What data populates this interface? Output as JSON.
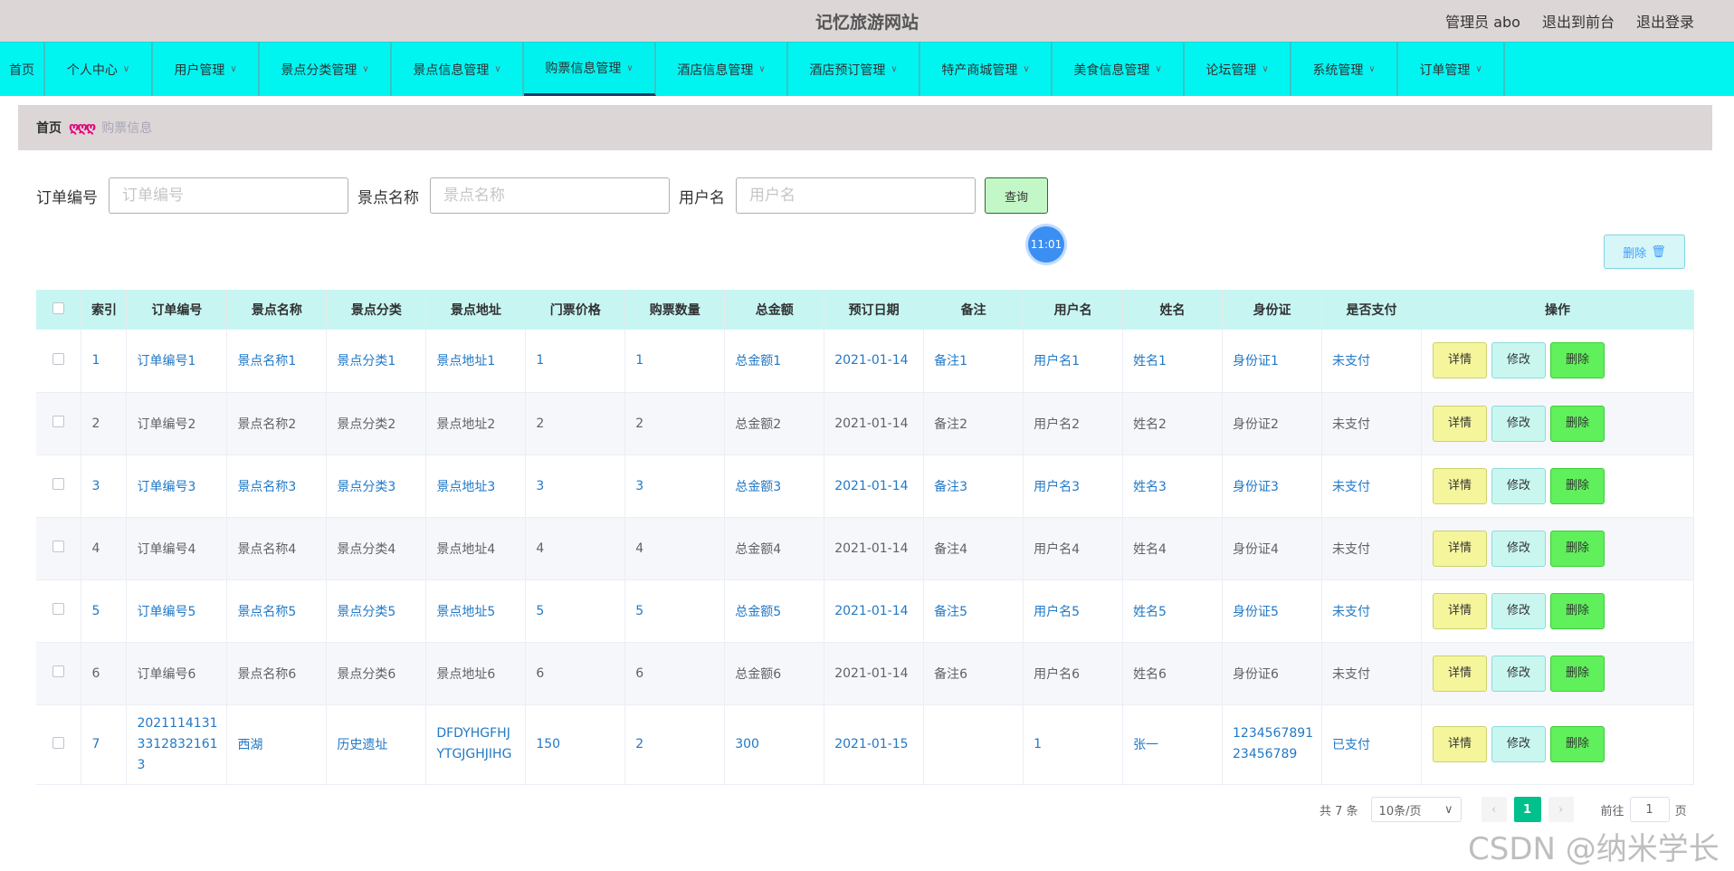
{
  "header": {
    "title": "记忆旅游网站",
    "admin_label": "管理员 abo",
    "back_link": "退出到前台",
    "logout_link": "退出登录"
  },
  "nav": {
    "items": [
      {
        "label": "首页",
        "has_dropdown": false
      },
      {
        "label": "个人中心",
        "has_dropdown": true
      },
      {
        "label": "用户管理",
        "has_dropdown": true
      },
      {
        "label": "景点分类管理",
        "has_dropdown": true
      },
      {
        "label": "景点信息管理",
        "has_dropdown": true
      },
      {
        "label": "购票信息管理",
        "has_dropdown": true
      },
      {
        "label": "酒店信息管理",
        "has_dropdown": true
      },
      {
        "label": "酒店预订管理",
        "has_dropdown": true
      },
      {
        "label": "特产商城管理",
        "has_dropdown": true
      },
      {
        "label": "美食信息管理",
        "has_dropdown": true
      },
      {
        "label": "论坛管理",
        "has_dropdown": true
      },
      {
        "label": "系统管理",
        "has_dropdown": true
      },
      {
        "label": "订单管理",
        "has_dropdown": true
      }
    ],
    "active": "购票信息管理"
  },
  "breadcrumb": {
    "home": "首页",
    "separator": "ღღღ",
    "current": "购票信息"
  },
  "search": {
    "order_label": "订单编号",
    "order_placeholder": "订单编号",
    "spot_label": "景点名称",
    "spot_placeholder": "景点名称",
    "user_label": "用户名",
    "user_placeholder": "用户名",
    "query_button": "查询"
  },
  "clock": "11:01",
  "toolbar": {
    "delete_label": "删除"
  },
  "table": {
    "columns": [
      "索引",
      "订单编号",
      "景点名称",
      "景点分类",
      "景点地址",
      "门票价格",
      "购票数量",
      "总金额",
      "预订日期",
      "备注",
      "用户名",
      "姓名",
      "身份证",
      "是否支付",
      "操作"
    ],
    "rows": [
      {
        "idx": "1",
        "order": "订单编号1",
        "spot": "景点名称1",
        "category": "景点分类1",
        "address": "景点地址1",
        "price": "1",
        "qty": "1",
        "total": "总金额1",
        "date": "2021-01-14",
        "note": "备注1",
        "user": "用户名1",
        "name": "姓名1",
        "id_card": "身份证1",
        "paid": "未支付"
      },
      {
        "idx": "2",
        "order": "订单编号2",
        "spot": "景点名称2",
        "category": "景点分类2",
        "address": "景点地址2",
        "price": "2",
        "qty": "2",
        "total": "总金额2",
        "date": "2021-01-14",
        "note": "备注2",
        "user": "用户名2",
        "name": "姓名2",
        "id_card": "身份证2",
        "paid": "未支付"
      },
      {
        "idx": "3",
        "order": "订单编号3",
        "spot": "景点名称3",
        "category": "景点分类3",
        "address": "景点地址3",
        "price": "3",
        "qty": "3",
        "total": "总金额3",
        "date": "2021-01-14",
        "note": "备注3",
        "user": "用户名3",
        "name": "姓名3",
        "id_card": "身份证3",
        "paid": "未支付"
      },
      {
        "idx": "4",
        "order": "订单编号4",
        "spot": "景点名称4",
        "category": "景点分类4",
        "address": "景点地址4",
        "price": "4",
        "qty": "4",
        "total": "总金额4",
        "date": "2021-01-14",
        "note": "备注4",
        "user": "用户名4",
        "name": "姓名4",
        "id_card": "身份证4",
        "paid": "未支付"
      },
      {
        "idx": "5",
        "order": "订单编号5",
        "spot": "景点名称5",
        "category": "景点分类5",
        "address": "景点地址5",
        "price": "5",
        "qty": "5",
        "total": "总金额5",
        "date": "2021-01-14",
        "note": "备注5",
        "user": "用户名5",
        "name": "姓名5",
        "id_card": "身份证5",
        "paid": "未支付"
      },
      {
        "idx": "6",
        "order": "订单编号6",
        "spot": "景点名称6",
        "category": "景点分类6",
        "address": "景点地址6",
        "price": "6",
        "qty": "6",
        "total": "总金额6",
        "date": "2021-01-14",
        "note": "备注6",
        "user": "用户名6",
        "name": "姓名6",
        "id_card": "身份证6",
        "paid": "未支付"
      },
      {
        "idx": "7",
        "order_lines": [
          "2021114131",
          "3312832161",
          "3"
        ],
        "spot": "西湖",
        "category": "历史遗址",
        "address_lines": [
          "DFDYHGFHJ",
          "YTGJGHJIHG"
        ],
        "price": "150",
        "qty": "2",
        "total": "300",
        "date": "2021-01-15",
        "note": "",
        "user": "1",
        "name": "张一",
        "id_card_lines": [
          "1234567891",
          "23456789"
        ],
        "paid": "已支付"
      }
    ],
    "actions": {
      "detail": "详情",
      "edit": "修改",
      "delete": "删除"
    }
  },
  "pagination": {
    "total": "共 7 条",
    "page_size": "10条/页",
    "current_page": "1",
    "goto_label": "前往",
    "goto_value": "1",
    "page_suffix": "页"
  },
  "watermark": "CSDN @纳米学长",
  "colors": {
    "nav_bg": "#00f5f1",
    "header_bg": "#dcd6d6",
    "link_blue": "#2279c6",
    "active_page": "#00c08b"
  }
}
